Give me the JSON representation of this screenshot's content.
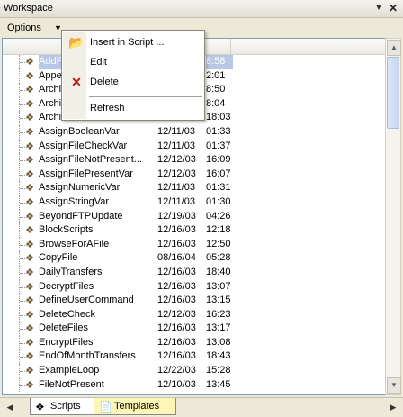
{
  "window": {
    "title": "Workspace"
  },
  "toolbar": {
    "options_label": "Options"
  },
  "table": {
    "headers": [
      "Te",
      "",
      ""
    ],
    "rows": [
      {
        "name": "AddF",
        "date": "",
        "time": "8:58",
        "selected": true
      },
      {
        "name": "Appe",
        "date": "",
        "time": "2:01"
      },
      {
        "name": "Archiv",
        "date": "",
        "time": "8:50"
      },
      {
        "name": "Archiv",
        "date": "",
        "time": "8:04"
      },
      {
        "name": "ArchiveSource",
        "date": "12/10/03",
        "time": "18:03"
      },
      {
        "name": "AssignBooleanVar",
        "date": "12/11/03",
        "time": "01:33"
      },
      {
        "name": "AssignFileCheckVar",
        "date": "12/11/03",
        "time": "01:37"
      },
      {
        "name": "AssignFileNotPresent...",
        "date": "12/12/03",
        "time": "16:09"
      },
      {
        "name": "AssignFilePresentVar",
        "date": "12/12/03",
        "time": "16:07"
      },
      {
        "name": "AssignNumericVar",
        "date": "12/11/03",
        "time": "01:31"
      },
      {
        "name": "AssignStringVar",
        "date": "12/11/03",
        "time": "01:30"
      },
      {
        "name": "BeyondFTPUpdate",
        "date": "12/19/03",
        "time": "04:26"
      },
      {
        "name": "BlockScripts",
        "date": "12/16/03",
        "time": "12:18"
      },
      {
        "name": "BrowseForAFile",
        "date": "12/16/03",
        "time": "12:50"
      },
      {
        "name": "CopyFile",
        "date": "08/16/04",
        "time": "05:28"
      },
      {
        "name": "DailyTransfers",
        "date": "12/16/03",
        "time": "18:40"
      },
      {
        "name": "DecryptFiles",
        "date": "12/16/03",
        "time": "13:07"
      },
      {
        "name": "DefineUserCommand",
        "date": "12/16/03",
        "time": "13:15"
      },
      {
        "name": "DeleteCheck",
        "date": "12/12/03",
        "time": "16:23"
      },
      {
        "name": "DeleteFiles",
        "date": "12/16/03",
        "time": "13:17"
      },
      {
        "name": "EncryptFiles",
        "date": "12/16/03",
        "time": "13:08"
      },
      {
        "name": "EndOfMonthTransfers",
        "date": "12/16/03",
        "time": "18:43"
      },
      {
        "name": "ExampleLoop",
        "date": "12/22/03",
        "time": "15:28"
      },
      {
        "name": "FileNotPresent",
        "date": "12/10/03",
        "time": "13:45"
      }
    ]
  },
  "context_menu": {
    "items": [
      {
        "label": "Insert in Script ...",
        "icon": "open-folder-icon"
      },
      {
        "label": "Edit",
        "icon": ""
      },
      {
        "label": "Delete",
        "icon": "red-x-icon"
      },
      {
        "label": "Refresh",
        "icon": ""
      }
    ]
  },
  "tabs": [
    {
      "label": "Scripts",
      "icon": "script-icon"
    },
    {
      "label": "Templates",
      "icon": "template-icon"
    }
  ],
  "colors": {
    "selection": "#b9c7e6",
    "templates_tab": "#fcf7b6",
    "accent": "#4d6185"
  }
}
